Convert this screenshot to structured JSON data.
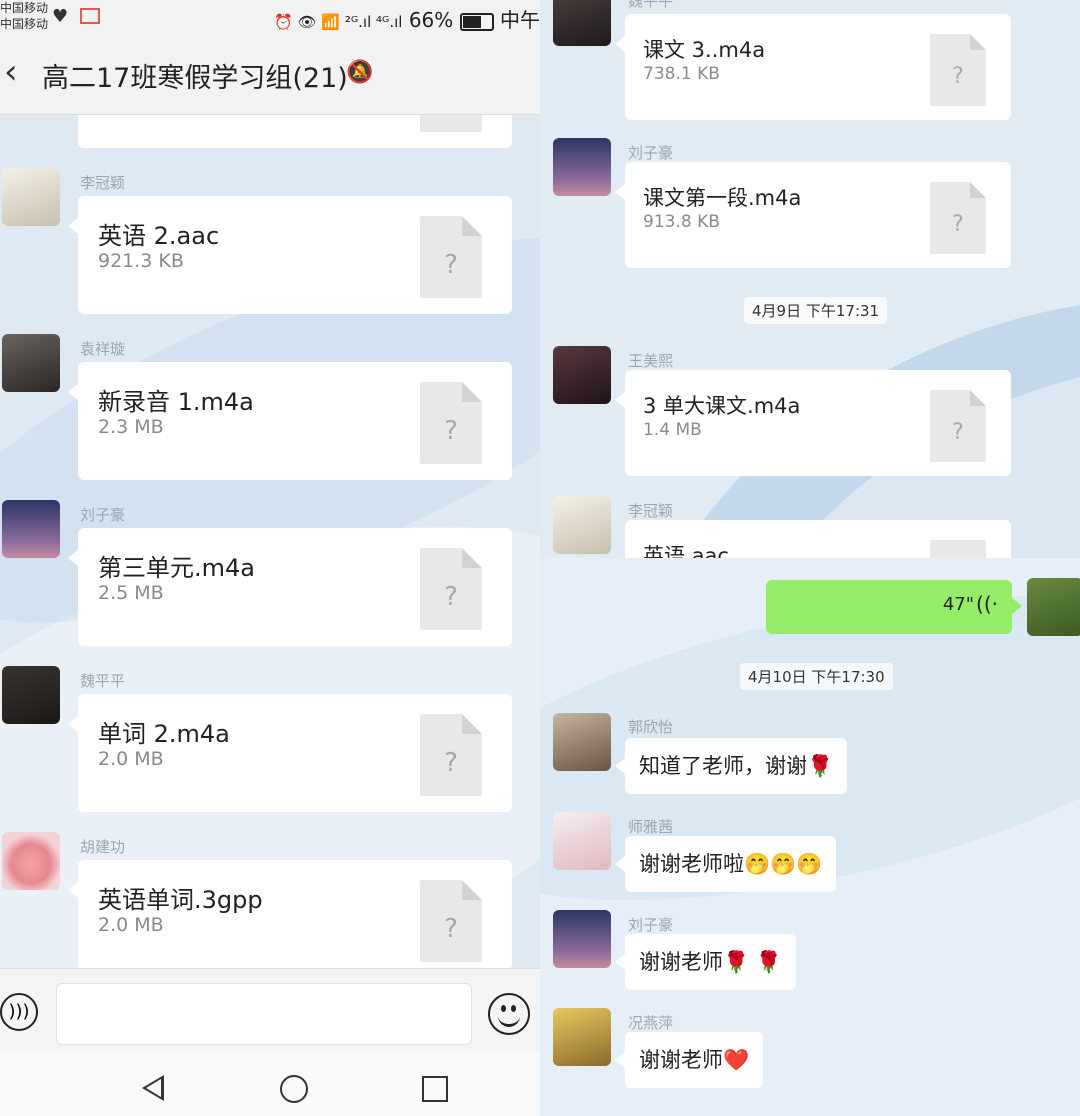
{
  "status_bar": {
    "carrier1": "中国移动",
    "carrier2": "中国移动",
    "icons_right": "⏰ 👁 📶 ²ᴳ.ıl ⁴ᴳ.ıl",
    "battery": "66%",
    "time": "中午"
  },
  "chat": {
    "back_icon": "chevron-left-icon",
    "title": "高二17班寒假学习组(21)",
    "mute_icon": "bell-off-icon"
  },
  "left_messages": [
    {
      "sender": "李冠颖",
      "file_name": "英语 2.aac",
      "file_size": "921.3 KB"
    },
    {
      "sender": "袁祥璇",
      "file_name": "新录音 1.m4a",
      "file_size": "2.3 MB"
    },
    {
      "sender": "刘子豪",
      "file_name": "第三单元.m4a",
      "file_size": "2.5 MB"
    },
    {
      "sender": "魏平平",
      "file_name": "单词 2.m4a",
      "file_size": "2.0 MB"
    },
    {
      "sender": "胡建功",
      "file_name": "英语单词.3gpp",
      "file_size": "2.0 MB"
    }
  ],
  "right_top": {
    "partial_sender_top": "魏平平",
    "messages": [
      {
        "sender": "",
        "file_name": "课文 3..m4a",
        "file_size": "738.1 KB"
      },
      {
        "sender": "刘子豪",
        "file_name": "课文第一段.m4a",
        "file_size": "913.8 KB"
      }
    ],
    "time_divider": "4月9日 下午17:31",
    "messages_after": [
      {
        "sender": "王美熙",
        "file_name": "3 单大课文.m4a",
        "file_size": "1.4 MB"
      },
      {
        "sender": "李冠颖",
        "file_name": "英语.aac",
        "file_size": ""
      }
    ]
  },
  "right_bottom": {
    "voice_duration": "47\"",
    "voice_icon": "voice-wave-icon",
    "time_divider": "4月10日 下午17:30",
    "messages": [
      {
        "sender": "郭欣怡",
        "text": "知道了老师，谢谢🌹"
      },
      {
        "sender": "师雅茜",
        "text": "谢谢老师啦🤭🤭🤭"
      },
      {
        "sender": "刘子豪",
        "text": "谢谢老师🌹 🌹"
      },
      {
        "sender": "况燕萍",
        "text": "谢谢老师❤️"
      }
    ]
  },
  "input_bar": {
    "voice_icon": "voice-input-icon",
    "emoji_icon": "emoji-icon",
    "placeholder": ""
  },
  "nav_bar": {
    "back": "nav-back-icon",
    "home": "nav-home-icon",
    "recent": "nav-recent-icon"
  },
  "file_icon_glyph": "?"
}
